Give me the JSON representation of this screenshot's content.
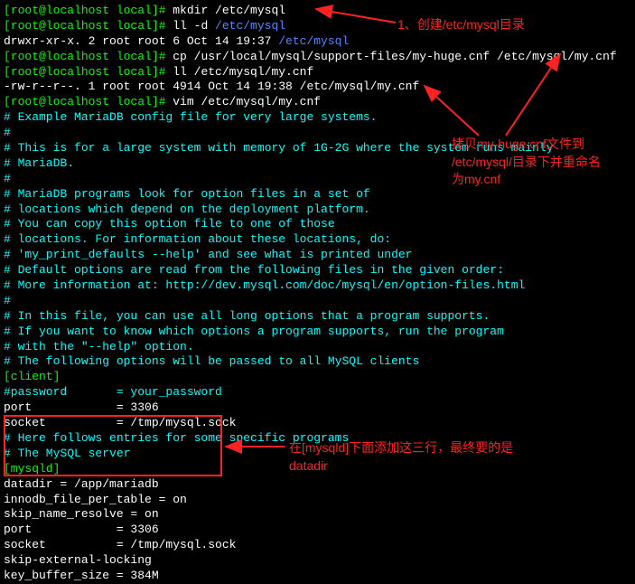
{
  "prompt1": "[root@localhost local]# ",
  "prompt2": "[root@localhost local]# ",
  "prompt3": "[root@localhost local]# ",
  "prompt4": "[root@localhost local]# ",
  "prompt5": "[root@localhost local]# ",
  "cmd1": "mkdir /etc/mysql",
  "cmd2": "ll -d ",
  "cmd2_path": "/etc/mysql",
  "ls_out": "drwxr-xr-x. 2 root root 6 Oct 14 19:37 ",
  "ls_path": "/etc/mysql",
  "cmd3": "cp /usr/local/mysql/support-files/my-huge.cnf /etc/mysql/my.cnf",
  "cmd4": "ll /etc/mysql/my.cnf",
  "ls_out2": "-rw-r--r--. 1 root root 4914 Oct 14 19:38 /etc/mysql/my.cnf",
  "cmd5": "vim /etc/mysql/my.cnf",
  "cfg": {
    "l1": "# Example MariaDB config file for very large systems.",
    "l2": "#",
    "l3": "# This is for a large system with memory of 1G-2G where the system runs mainly",
    "l4": "# MariaDB.",
    "l5": "#",
    "l6": "# MariaDB programs look for option files in a set of",
    "l7": "# locations which depend on the deployment platform.",
    "l8": "# You can copy this option file to one of those",
    "l9": "# locations. For information about these locations, do:",
    "l10": "# 'my_print_defaults --help' and see what is printed under",
    "l11": "# Default options are read from the following files in the given order:",
    "l12": "# More information at: http://dev.mysql.com/doc/mysql/en/option-files.html",
    "l13": "#",
    "l14": "# In this file, you can use all long options that a program supports.",
    "l15": "# If you want to know which options a program supports, run the program",
    "l16": "# with the \"--help\" option.",
    "l17": "",
    "l18": "# The following options will be passed to all MySQL clients",
    "l19": "[client]",
    "l20": "#password       = your_password",
    "l21": "port            = 3306",
    "l22": "socket          = /tmp/mysql.sock",
    "l23": "",
    "l24": "# Here follows entries for some specific programs",
    "l25": "",
    "l26": "# The MySQL server",
    "l27": "[mysqld]",
    "l28": "datadir = /app/mariadb",
    "l29": "innodb_file_per_table = on",
    "l30": "skip_name_resolve = on",
    "l31": "",
    "l32": "port            = 3306",
    "l33": "socket          = /tmp/mysql.sock",
    "l34": "skip-external-locking",
    "l35": "key_buffer_size = 384M"
  },
  "anno1": "1、创建/etc/mysql目录",
  "anno2_l1": "拷贝my-huge.cnf文件到",
  "anno2_l2": "/etc/mysql/目录下并重命名",
  "anno2_l3": "为my.cnf",
  "anno3_l1": "在[mysqld]下面添加这三行，最终要的是",
  "anno3_l2": "datadir"
}
